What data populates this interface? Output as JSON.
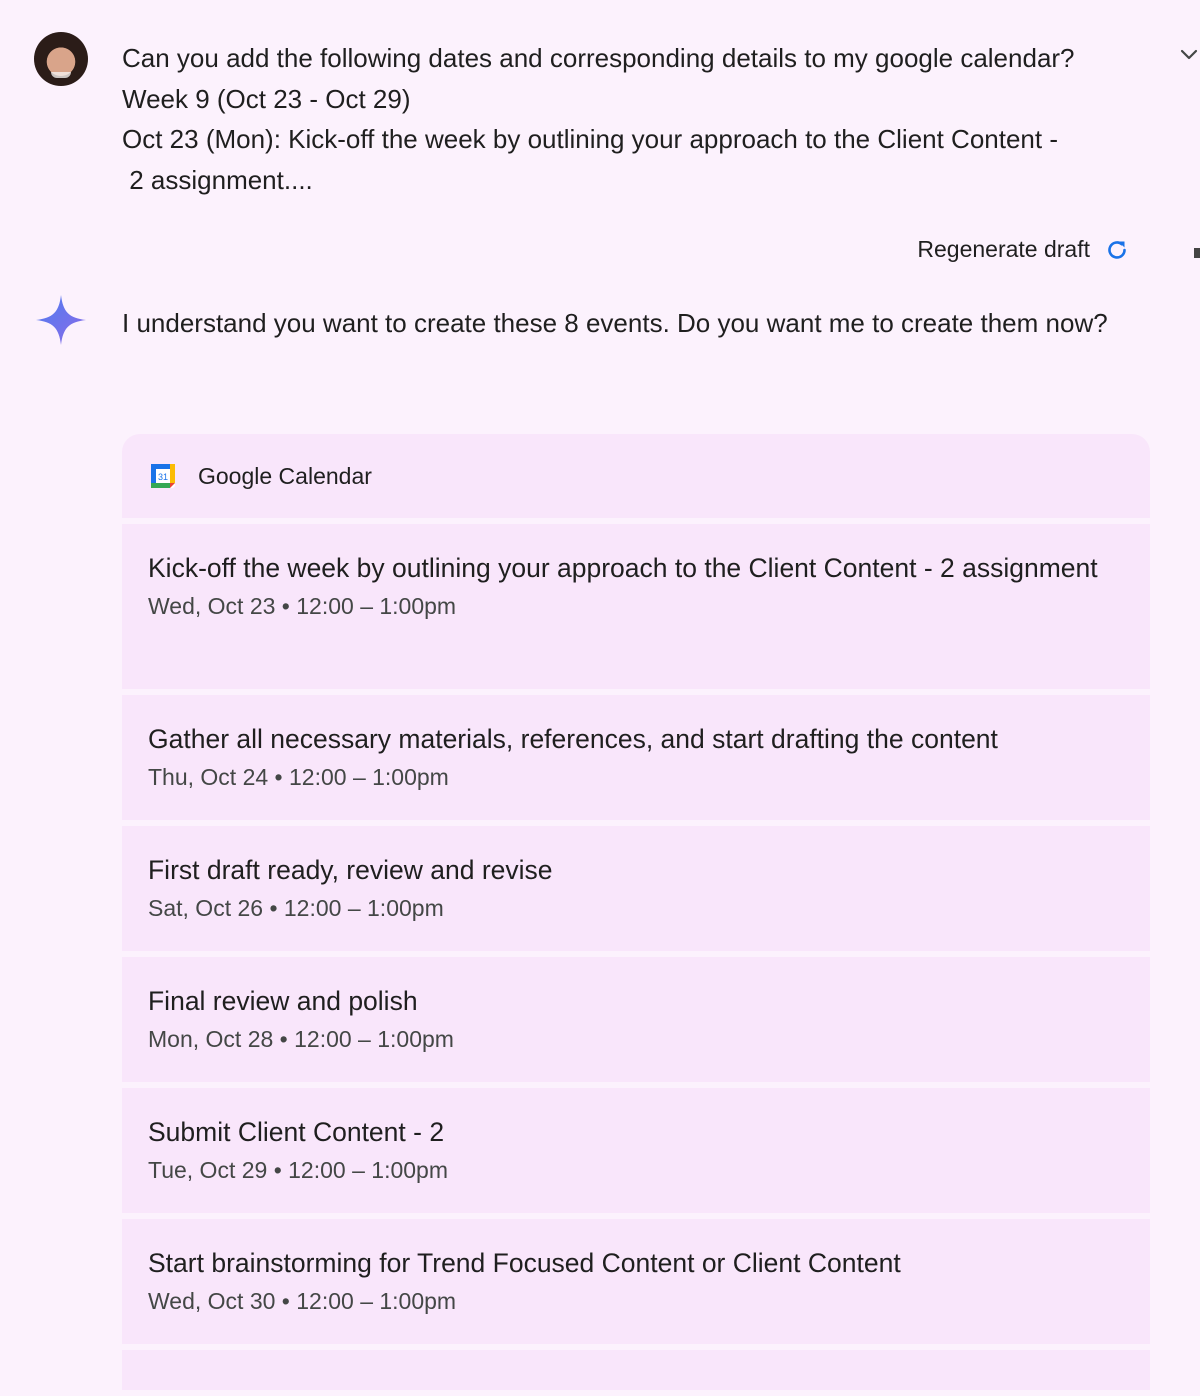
{
  "user_message": {
    "lines": [
      "Can you add the following dates and corresponding details to my google calendar?",
      "Week 9 (Oct 23 - Oct 29)",
      "Oct 23 (Mon): Kick-off the week by outlining your approach to the Client Content -",
      " 2 assignment...."
    ]
  },
  "regenerate": {
    "label": "Regenerate draft"
  },
  "assistant_message": {
    "text": "I understand you want to create these 8 events. Do you want me to create them now?"
  },
  "calendar": {
    "name": "Google Calendar",
    "icon_day": "31",
    "events": [
      {
        "title": "Kick-off the week by outlining your approach to the Client Content - 2 assignment",
        "time": "Wed, Oct 23 • 12:00 – 1:00pm"
      },
      {
        "title": "Gather all necessary materials, references, and start drafting the content",
        "time": "Thu, Oct 24 • 12:00 – 1:00pm"
      },
      {
        "title": "First draft ready, review and revise",
        "time": "Sat, Oct 26 • 12:00 – 1:00pm"
      },
      {
        "title": "Final review and polish",
        "time": "Mon, Oct 28 • 12:00 – 1:00pm"
      },
      {
        "title": "Submit Client Content - 2",
        "time": "Tue, Oct 29 • 12:00 – 1:00pm"
      },
      {
        "title": "Start brainstorming for Trend Focused Content or Client Content",
        "time": "Wed, Oct 30 • 12:00 – 1:00pm"
      }
    ]
  },
  "colors": {
    "background": "#fcf2fd",
    "card": "#f9e6fb",
    "accent_blue": "#1a73e8",
    "secondary_text": "#444746"
  },
  "icons": [
    "user-avatar",
    "chevron-down-icon",
    "refresh-icon",
    "gemini-sparkle-icon",
    "google-calendar-icon"
  ]
}
